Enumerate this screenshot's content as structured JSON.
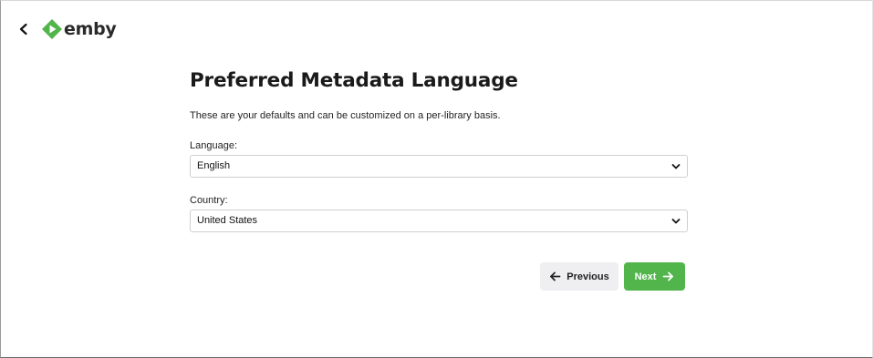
{
  "header": {
    "logo_text": "emby",
    "back_icon": "arrow-back-icon",
    "logo_icon": "emby-logo-icon",
    "brand_color": "#52b54b"
  },
  "main": {
    "title": "Preferred Metadata Language",
    "description": "These are your defaults and can be customized on a per-library basis.",
    "language": {
      "label": "Language:",
      "value": "English"
    },
    "country": {
      "label": "Country:",
      "value": "United States"
    }
  },
  "footer": {
    "previous_label": "Previous",
    "next_label": "Next",
    "next_color": "#52b54b"
  }
}
